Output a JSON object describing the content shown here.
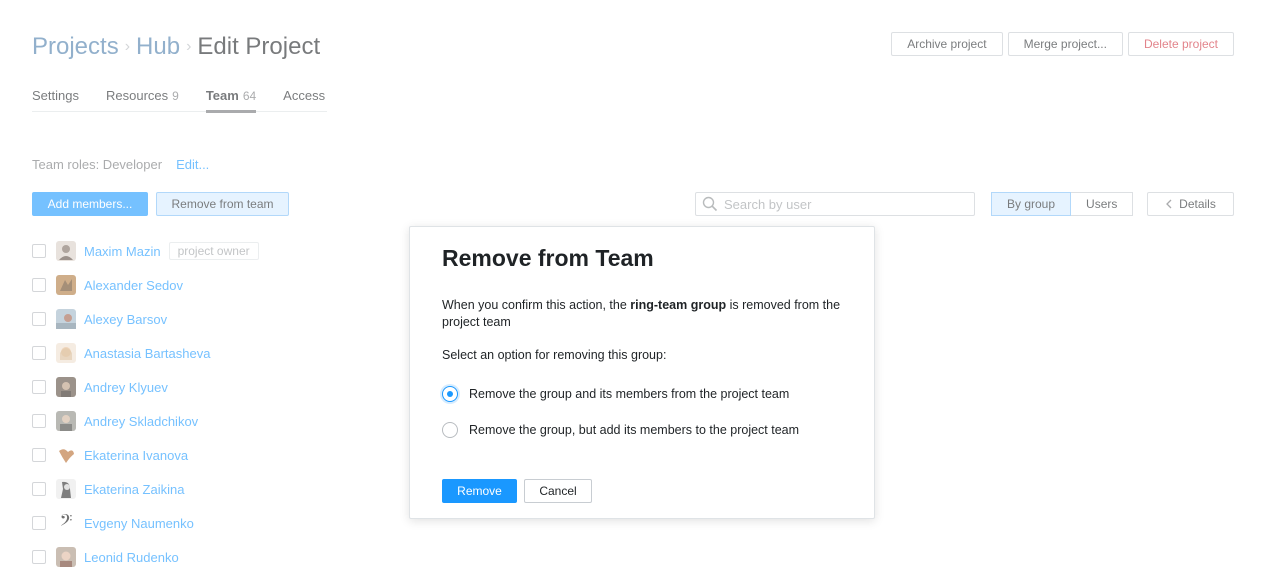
{
  "breadcrumb": {
    "items": [
      "Projects",
      "Hub"
    ],
    "current": "Edit Project",
    "separator": "›"
  },
  "header_actions": {
    "archive": "Archive project",
    "merge": "Merge project...",
    "delete": "Delete project"
  },
  "tabs": [
    {
      "label": "Settings",
      "count": ""
    },
    {
      "label": "Resources",
      "count": "9"
    },
    {
      "label": "Team",
      "count": "64",
      "active": true
    },
    {
      "label": "Access",
      "count": ""
    }
  ],
  "roles": {
    "text": "Team roles: Developer",
    "edit": "Edit..."
  },
  "toolbar": {
    "add_members": "Add members...",
    "remove_from_team": "Remove from team",
    "search_placeholder": "Search by user",
    "by_group": "By group",
    "users": "Users",
    "details": "Details"
  },
  "members": [
    {
      "name": "Maxim Mazin",
      "badge": "project owner"
    },
    {
      "name": "Alexander Sedov"
    },
    {
      "name": "Alexey Barsov"
    },
    {
      "name": "Anastasia Bartasheva"
    },
    {
      "name": "Andrey Klyuev"
    },
    {
      "name": "Andrey Skladchikov"
    },
    {
      "name": "Ekaterina Ivanova"
    },
    {
      "name": "Ekaterina Zaikina"
    },
    {
      "name": "Evgeny Naumenko"
    },
    {
      "name": "Leonid Rudenko"
    }
  ],
  "dialog": {
    "title": "Remove from Team",
    "text_before": "When you confirm this action, the ",
    "text_bold": "ring-team group",
    "text_after": " is removed from the project team",
    "prompt": "Select an option for removing this group:",
    "option1": "Remove the group and its members from the project team",
    "option2": "Remove the group, but add its members to the project team",
    "selected_option": 1,
    "remove": "Remove",
    "cancel": "Cancel"
  },
  "colors": {
    "accent": "#1a98ff",
    "link": "#4a7dab",
    "danger": "#d0313e"
  }
}
